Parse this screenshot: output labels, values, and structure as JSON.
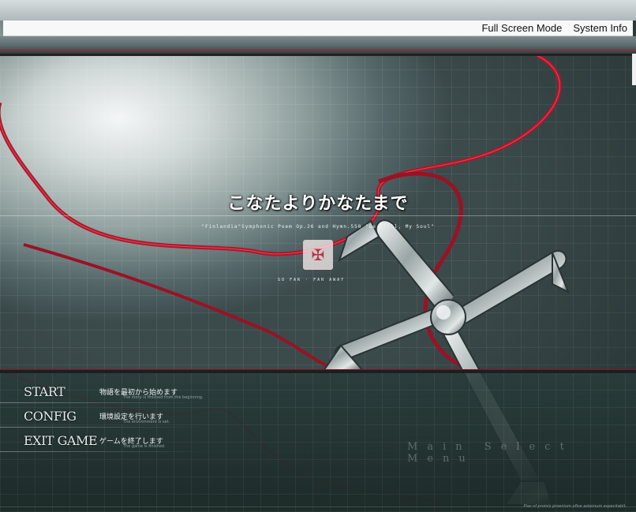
{
  "menubar": {
    "full_screen": "Full Screen Mode",
    "system_info": "System Info"
  },
  "title": {
    "main": "こなたよりかなたまで",
    "subtitle": "\"Finlandia\"Symphonic Poem Op.26 and Hymn.550 \"Be Still, My Soul\"",
    "tagline": "SO FAR  ·  FAR AWAY"
  },
  "main_menu": [
    {
      "label": "START",
      "desc": "物語を最初から始めます",
      "desc_en": "The story is finished from the beginning."
    },
    {
      "label": "CONFIG",
      "desc": "環境設定を行います",
      "desc_en": "The environment is set."
    },
    {
      "label": "EXIT GAME",
      "desc": "ゲームを終了します",
      "desc_en": "The game is finished."
    }
  ],
  "watermark": "Main Select Menu",
  "footer": "Pias of proinis proenium ofice asternum especitabit.",
  "colors": {
    "cord": "#b0162a",
    "accent_dark": "#1b1f20"
  },
  "icons": {
    "emblem": "cross-emblem-icon"
  }
}
